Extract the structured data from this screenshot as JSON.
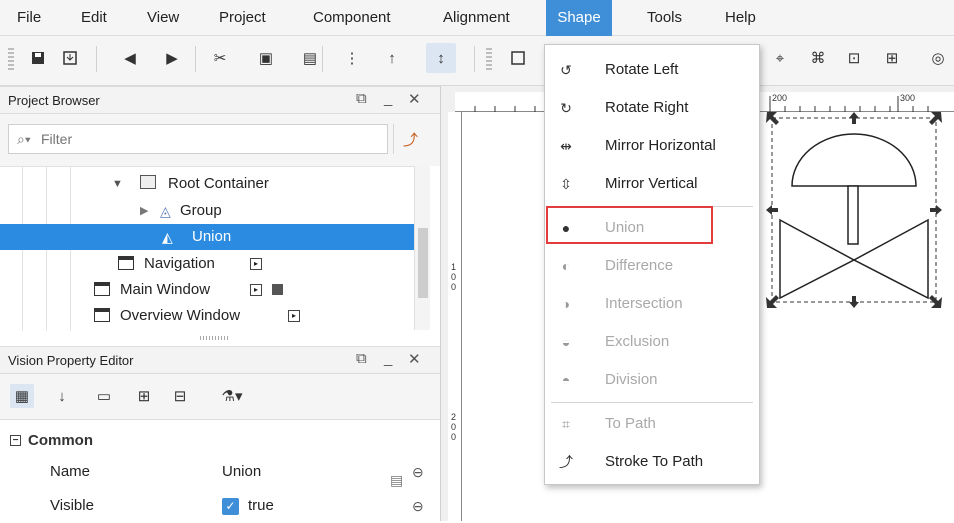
{
  "menubar": [
    "File",
    "Edit",
    "View",
    "Project",
    "Component",
    "Alignment",
    "Shape",
    "Tools",
    "Help"
  ],
  "menubar_active": "Shape",
  "colors": {
    "accent": "#3f8fd8",
    "selection": "#2b8be0",
    "highlight_box": "#e23c3c"
  },
  "toolbar_icons": [
    "save-icon",
    "save-to-icon",
    "undo-icon",
    "redo-icon",
    "cut-icon",
    "copy-icon",
    "paste-icon",
    "snap-icon",
    "bring-forward-icon",
    "send-backward-icon",
    "rectangle-icon"
  ],
  "project_browser": {
    "title": "Project Browser",
    "filter_placeholder": "Filter",
    "tree": [
      {
        "label": "Root Container",
        "icon": "root-container-icon"
      },
      {
        "label": "Group",
        "icon": "group-icon"
      },
      {
        "label": "Union",
        "icon": "union-shape-icon",
        "selected": true
      },
      {
        "label": "Navigation",
        "icon": "window-icon"
      },
      {
        "label": "Main Window",
        "icon": "window-icon"
      },
      {
        "label": "Overview Window",
        "icon": "window-icon"
      }
    ]
  },
  "property_editor": {
    "title": "Vision Property Editor",
    "category": "Common",
    "rows": [
      {
        "key": "Name",
        "value": "Union"
      },
      {
        "key": "Visible",
        "value": "true",
        "checked": true
      }
    ]
  },
  "ruler": {
    "top": [
      "200",
      "300"
    ],
    "left": [
      "1",
      "0",
      "0",
      "2",
      "0",
      "0"
    ]
  },
  "shape_menu": [
    {
      "label": "Rotate Left",
      "icon": "rotate-left-icon",
      "enabled": true
    },
    {
      "label": "Rotate Right",
      "icon": "rotate-right-icon",
      "enabled": true
    },
    {
      "label": "Mirror Horizontal",
      "icon": "mirror-horizontal-icon",
      "enabled": true
    },
    {
      "label": "Mirror Vertical",
      "icon": "mirror-vertical-icon",
      "enabled": true
    },
    {
      "label": "Union",
      "icon": "union-icon",
      "enabled": false,
      "highlighted": true
    },
    {
      "label": "Difference",
      "icon": "difference-icon",
      "enabled": false
    },
    {
      "label": "Intersection",
      "icon": "intersection-icon",
      "enabled": false
    },
    {
      "label": "Exclusion",
      "icon": "exclusion-icon",
      "enabled": false
    },
    {
      "label": "Division",
      "icon": "division-icon",
      "enabled": false
    },
    {
      "label": "To Path",
      "icon": "to-path-icon",
      "enabled": false
    },
    {
      "label": "Stroke To Path",
      "icon": "stroke-to-path-icon",
      "enabled": true
    }
  ]
}
